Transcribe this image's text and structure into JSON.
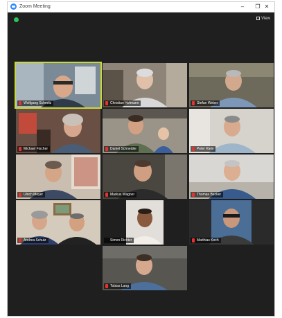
{
  "window": {
    "title": "Zoom Meeting",
    "minimize": "–",
    "maximize": "❐",
    "close": "✕",
    "shield_color": "#2ec35a"
  },
  "view_toggle": {
    "label": "View",
    "icon": "grid-icon"
  },
  "colors": {
    "background": "#1f1f1f",
    "active_speaker_border": "#c9d83a",
    "muted_mic": "#e8322e"
  },
  "participants": [
    {
      "name": "Wolfgang Schmitz",
      "muted": true,
      "active_speaker": true
    },
    {
      "name": "Christian Hofmann",
      "muted": true
    },
    {
      "name": "Stefan Weber",
      "muted": true
    },
    {
      "name": "Michael Fischer",
      "muted": true
    },
    {
      "name": "Daniel Schneider",
      "muted": true
    },
    {
      "name": "Peter Klein",
      "muted": true
    },
    {
      "name": "Ulrich Meyer",
      "muted": true
    },
    {
      "name": "Markus Wagner",
      "muted": true
    },
    {
      "name": "Thomas Becker",
      "muted": true
    },
    {
      "name": "Andrea Schulz",
      "muted": true
    },
    {
      "name": "Simon Richter",
      "muted": false
    },
    {
      "name": "Matthias Koch",
      "muted": true
    },
    {
      "name": "Tobias Lang",
      "muted": true
    }
  ]
}
